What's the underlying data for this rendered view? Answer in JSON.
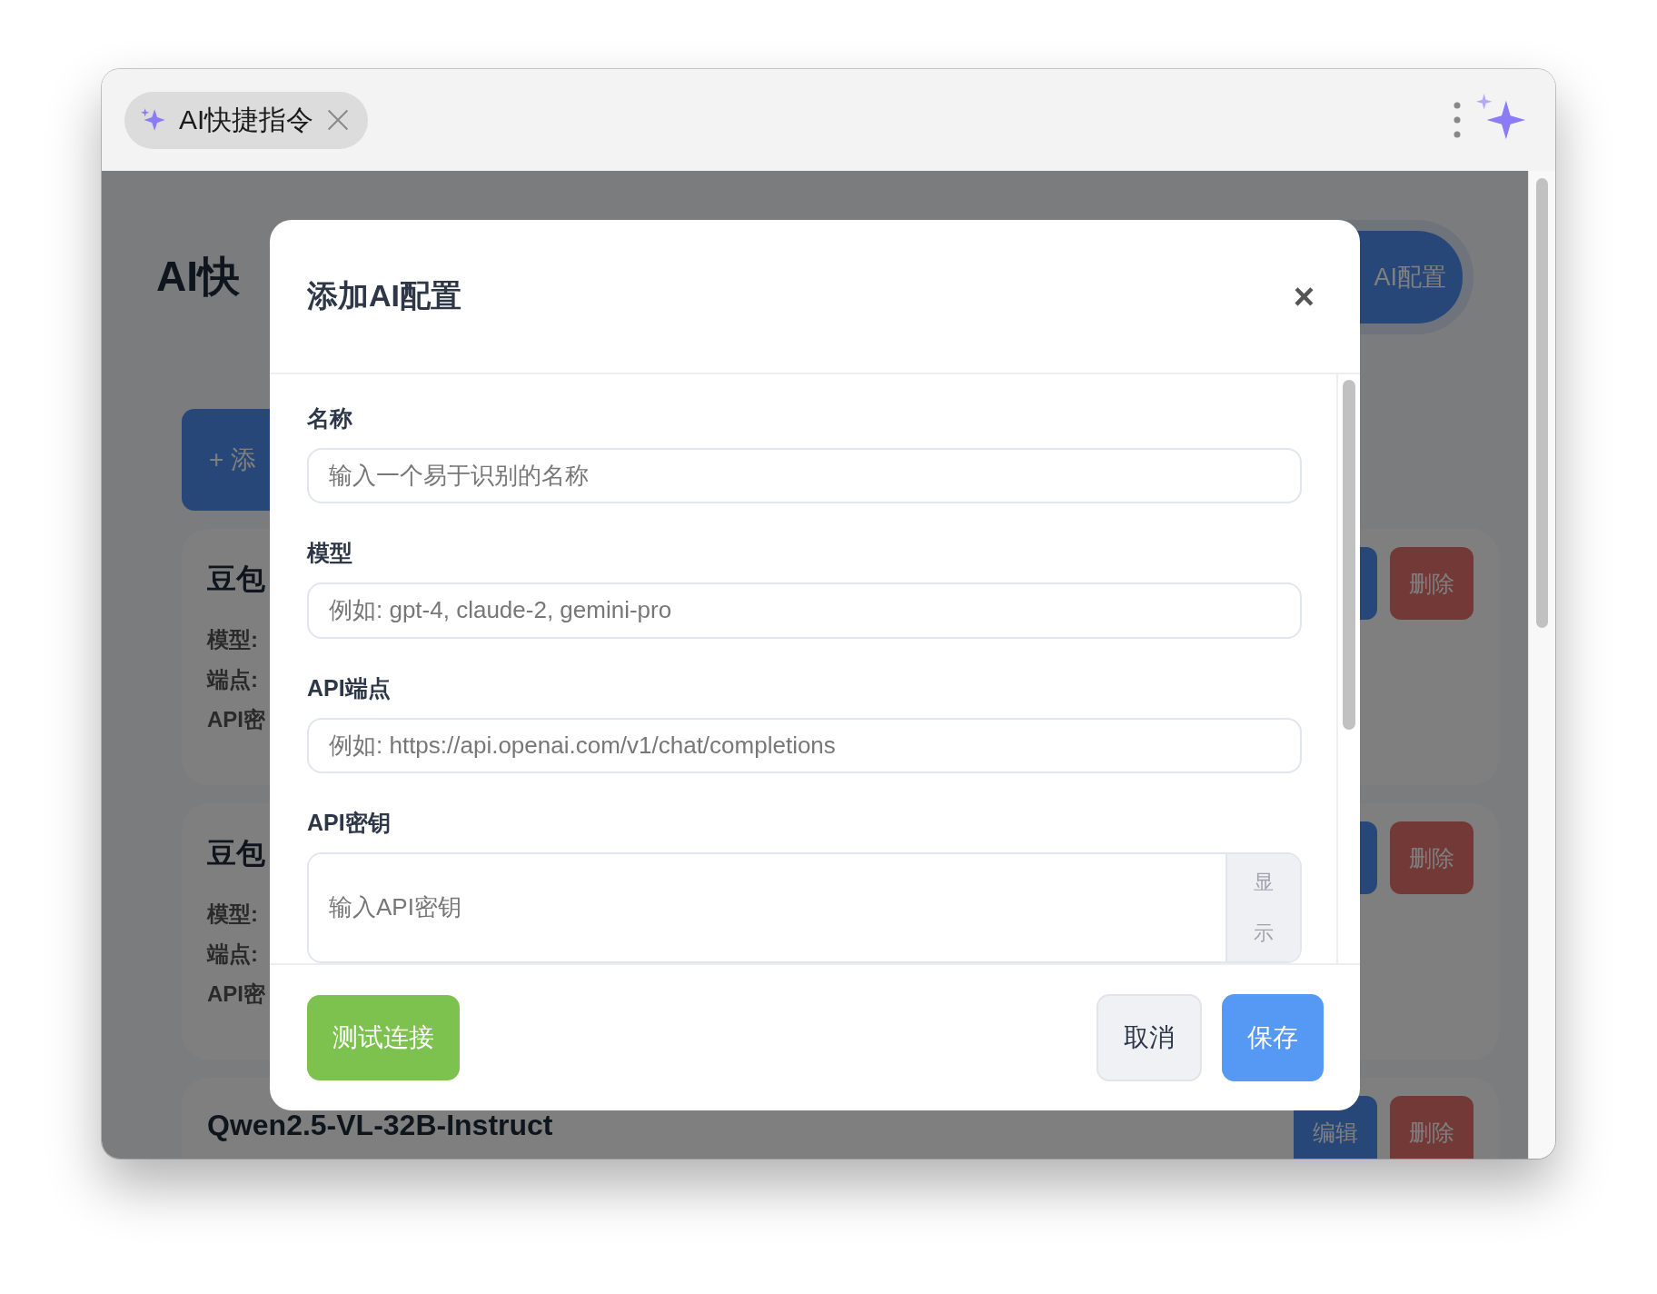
{
  "tab": {
    "label": "AI快捷指令"
  },
  "page": {
    "title": "AI快",
    "add_config_button": "AI配置",
    "add_button": "+ 添",
    "cards": [
      {
        "title": "豆包",
        "fields": [
          "模型:",
          "端点:",
          "API密"
        ],
        "buttons": [
          {
            "kind": "edit"
          },
          {
            "kind": "delete",
            "label": "删除"
          }
        ]
      },
      {
        "title": "豆包",
        "fields": [
          "模型:",
          "端点:",
          "API密"
        ],
        "buttons": [
          {
            "kind": "edit"
          },
          {
            "kind": "delete",
            "label": "删除"
          }
        ]
      },
      {
        "title": "Qwen2.5-VL-32B-Instruct",
        "buttons": [
          {
            "kind": "edit",
            "label": "编辑"
          },
          {
            "kind": "delete",
            "label": "删除"
          }
        ]
      }
    ]
  },
  "dialog": {
    "title": "添加AI配置",
    "close": "×",
    "fields": [
      {
        "label": "名称",
        "placeholder": "输入一个易于识别的名称"
      },
      {
        "label": "模型",
        "placeholder": "例如: gpt-4, claude-2, gemini-pro"
      },
      {
        "label": "API端点",
        "placeholder": "例如: https://api.openai.com/v1/chat/completions"
      },
      {
        "label": "API密钥",
        "placeholder": "输入API密钥",
        "toggle": "显示"
      }
    ],
    "test_button": "测试连接",
    "cancel_button": "取消",
    "save_button": "保存"
  }
}
